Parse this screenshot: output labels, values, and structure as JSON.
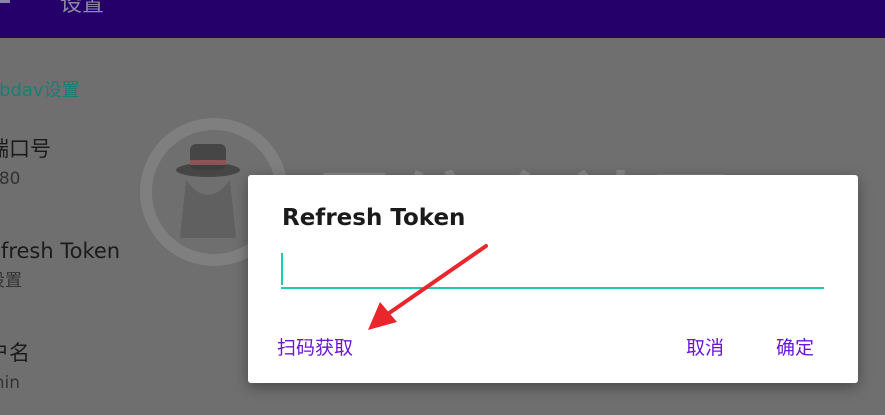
{
  "appbar": {
    "title": "设置"
  },
  "settings": {
    "section_title": "ebdav设置",
    "items": [
      {
        "title": "端口号",
        "summary": "080"
      },
      {
        "title": "efresh Token",
        "summary": "设置"
      },
      {
        "title": "户名",
        "summary": "min"
      }
    ]
  },
  "watermark": {
    "text": "吾综合社区",
    "url": "www.l3zh.com"
  },
  "dialog": {
    "title": "Refresh Token",
    "input_value": "",
    "scan_label": "扫码获取",
    "cancel_label": "取消",
    "ok_label": "确定"
  },
  "colors": {
    "appbar": "#25006b",
    "accent": "#1fc9b5",
    "button_text": "#6a16d8",
    "annotation_arrow": "#e8262b"
  }
}
